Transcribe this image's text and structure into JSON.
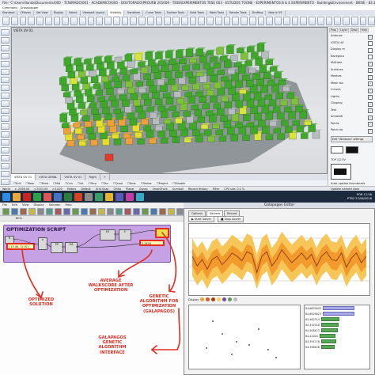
{
  "rhino": {
    "title": "File: 'C:\\Users\\Ilanda\\Documents\\000 - TCN\\MADO\\001 - ACADEMICO\\000 - DOUTORADO\\PROURB 201009 - TESE\\EXPERIMENTOS TESE 003 - ESTUDOS TOONE - EXPERIMENTOS B & E EXPERIMENTO - Building&Environment - BRISE - 83.3dm' successfully read",
    "command": "Command: _Grasshopper",
    "tabs": [
      "Standard",
      "CPlanes",
      "Set View",
      "Display",
      "Select",
      "Viewport Layout",
      "Visibility",
      "Transform",
      "Curve Tools",
      "Surface Tools",
      "Solid Tools",
      "Mesh Tools",
      "Render Tools",
      "Drafting",
      "New in V5"
    ],
    "active_tab_index": 6,
    "viewport_label": "VISTA UV 01",
    "viewport_tabs": [
      "VISTA UV 01",
      "VISTA GERAL",
      "VISTA UV 01",
      "Right"
    ],
    "snaps": [
      "End",
      "Near",
      "Point",
      "Mid",
      "Cen",
      "Int",
      "Perp",
      "Tan",
      "Quad",
      "Knot",
      "Vertex",
      "Project",
      "Disable"
    ],
    "status": [
      "World",
      "x -2456.04",
      "y 2543.04",
      "z 0.000",
      "Meters",
      "Default",
      "Grid Snap",
      "Ortho",
      "Planar",
      "Osnap",
      "SmartTrack",
      "Gumball",
      "Record History",
      "Filter",
      "CPU use: 0.0 %"
    ]
  },
  "right_panel": {
    "tabs": [
      "Prop",
      "Layer",
      "Displ",
      "Help"
    ],
    "rows": [
      {
        "label": "Antenas",
        "checked": true
      },
      {
        "label": "VISTA UV",
        "checked": false
      },
      {
        "label": "Display m",
        "checked": false
      },
      {
        "label": "Backgrou",
        "checked": false
      },
      {
        "label": "Multiple",
        "checked": true
      },
      {
        "label": "Surfaces",
        "checked": true
      },
      {
        "label": "Meshes",
        "checked": true
      },
      {
        "label": "Mesh Iso",
        "checked": true
      },
      {
        "label": "Curves",
        "checked": true
      },
      {
        "label": "Lights",
        "checked": true
      },
      {
        "label": "Clipping",
        "checked": true
      },
      {
        "label": "Text",
        "checked": true
      },
      {
        "label": "Annotati",
        "checked": true
      },
      {
        "label": "Points",
        "checked": true
      },
      {
        "label": "Point clo",
        "checked": true
      }
    ],
    "button": "Edit \"Windows\" settings",
    "label_top": "TOP 1/2.5V",
    "auto_update": "Auto update thumbnails",
    "named_views": "Update named view thumbnail",
    "sync": "Auto update (F)"
  },
  "taskbar": {
    "lang": "POR",
    "lang2": "PTB2",
    "time": "11:56",
    "date": "27/06/2016"
  },
  "grasshopper": {
    "menus": [
      "File",
      "Edit",
      "View",
      "Display",
      "Solution",
      "Help"
    ],
    "zoom": "80%",
    "group_title": "OPTIMIZATION SCRIPT",
    "nodes": [
      "N",
      "A",
      "EE",
      "GA",
      "EX",
      "E"
    ],
    "panel_left": "( 15.48, 12.92 )",
    "panel_right": "0.3456",
    "annotations": {
      "optimized": "OPTIMIZED SOLUTION",
      "walkscore": "AVERAGE WALKSCORE AFTER OPTIMIZATION",
      "genetic": "GENETIC ALGORITHM FOR OPTIMIZATION (GALAPAGOS)",
      "interface": "GALAPAGOS GENETIC ALGORITHM INTERFACE"
    }
  },
  "galapagos": {
    "title": "Galapagos Editor",
    "tabs": [
      "Options",
      "Solvers",
      "Record"
    ],
    "active_tab_index": 1,
    "buttons": [
      "Start Solver",
      "Stop Solver"
    ],
    "display_label": "Display",
    "list_values": [
      "84.6825635",
      "84.6825623",
      "84.462314",
      "84.432518",
      "84.408423",
      "84.41024",
      "84.391278",
      "84.398428"
    ],
    "colors": {
      "band_outer": "#f7c659",
      "band_inner": "#f39a2d",
      "line": "#8a3a10"
    }
  },
  "chart_data": {
    "type": "area",
    "series": [
      {
        "values": [
          0.55,
          0.4,
          0.5,
          0.35,
          0.5,
          0.55,
          0.42,
          0.5,
          0.6,
          0.55,
          0.48,
          0.62,
          0.58,
          0.3,
          0.55,
          0.62,
          0.4,
          0.5,
          0.65,
          0.55,
          0.45,
          0.52,
          0.6,
          0.5,
          0.58,
          0.4,
          0.55,
          0.62,
          0.5,
          0.48,
          0.6,
          0.38,
          0.52,
          0.6,
          0.45,
          0.55
        ]
      }
    ]
  }
}
